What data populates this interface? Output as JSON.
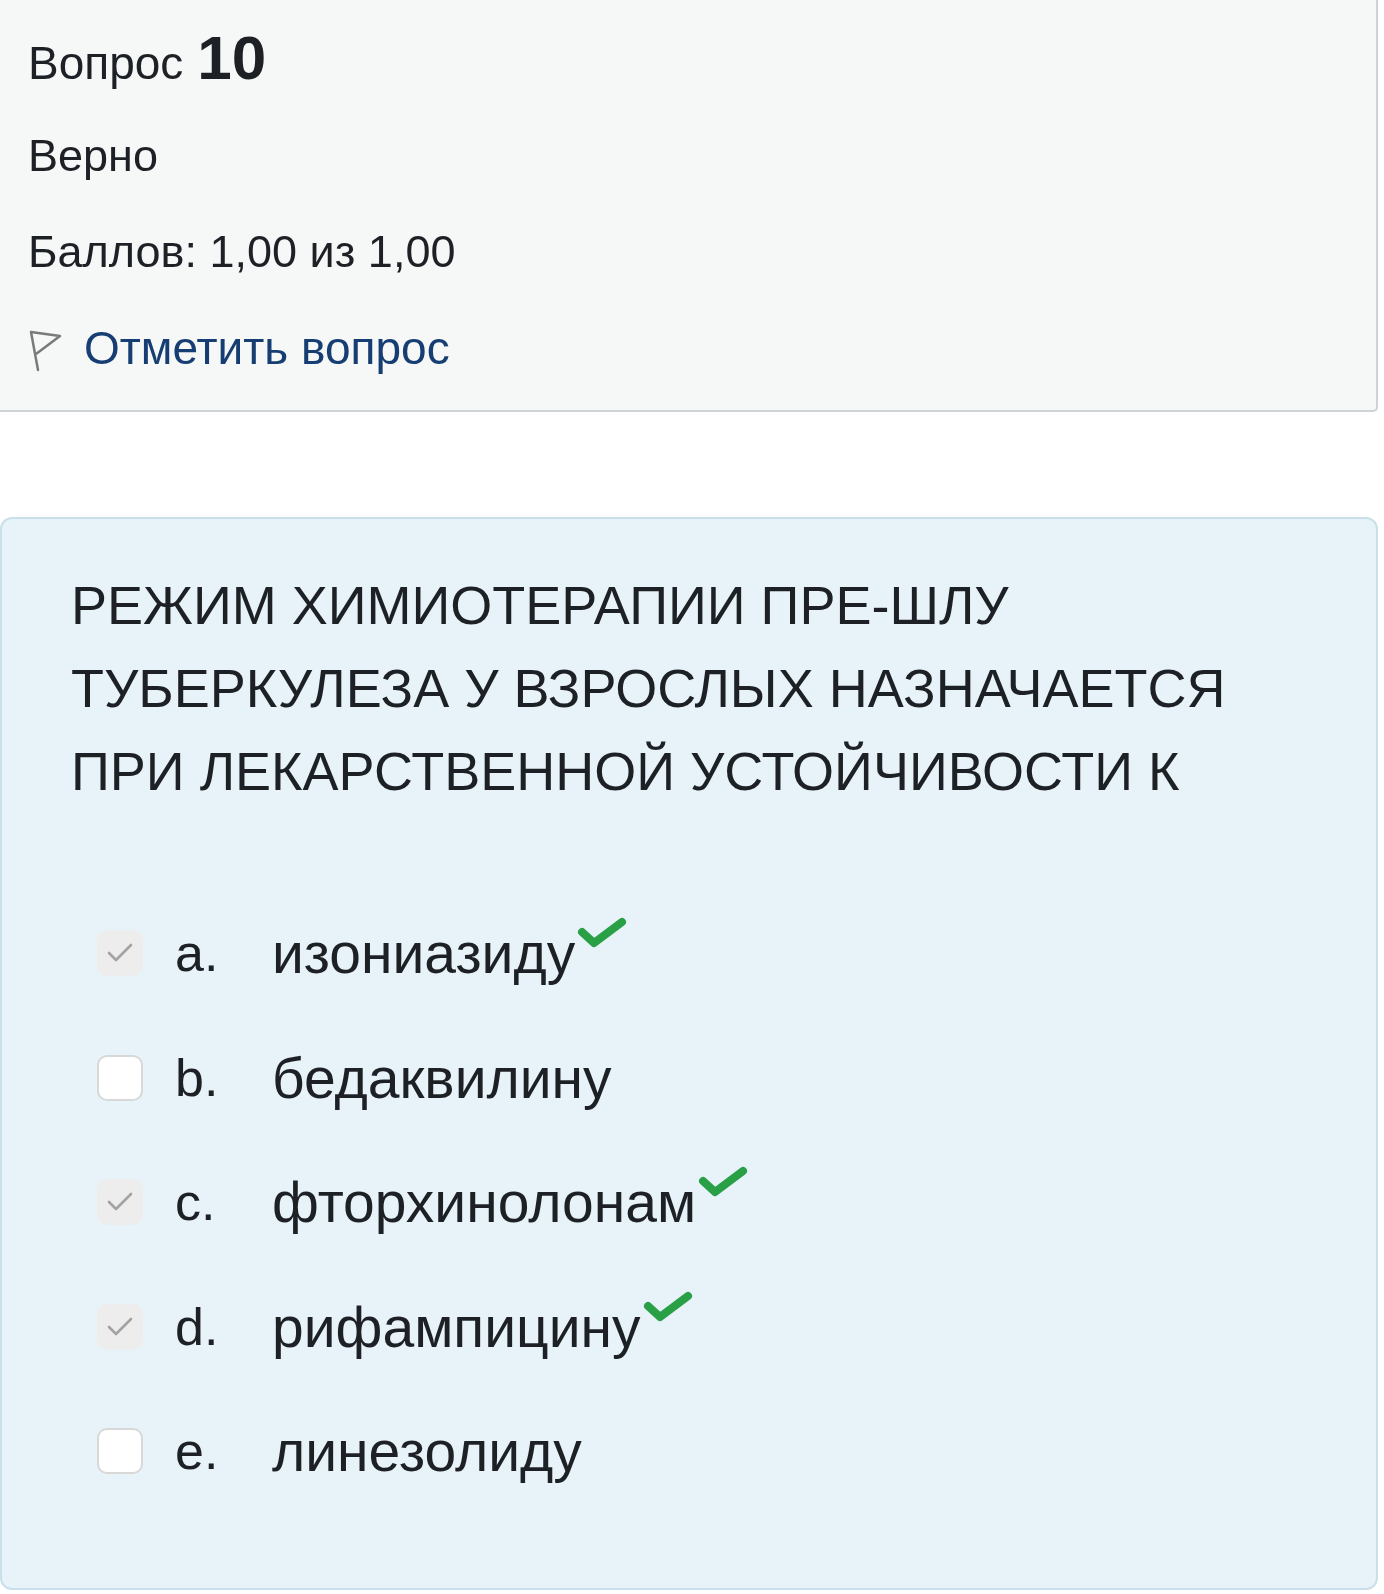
{
  "question_info": {
    "label": "Вопрос",
    "number": "10",
    "status": "Верно",
    "grade": "Баллов: 1,00 из 1,00",
    "flag_link": "Отметить вопрос"
  },
  "question": {
    "text": "РЕЖИМ ХИМИОТЕРАПИИ ПРЕ-ШЛУ ТУБЕРКУЛЕЗА У ВЗРОСЛЫХ НАЗНАЧАЕТСЯ ПРИ ЛЕКАРСТВЕННОЙ УСТОЙЧИВОСТИ К"
  },
  "options": [
    {
      "letter": "a.",
      "text": "изониазиду",
      "checked": true,
      "correct": true
    },
    {
      "letter": "b.",
      "text": "бедаквилину",
      "checked": false,
      "correct": false
    },
    {
      "letter": "c.",
      "text": "фторхинолонам",
      "checked": true,
      "correct": true
    },
    {
      "letter": "d.",
      "text": "рифампицину",
      "checked": true,
      "correct": true
    },
    {
      "letter": "e.",
      "text": "линезолиду",
      "checked": false,
      "correct": false
    }
  ]
}
